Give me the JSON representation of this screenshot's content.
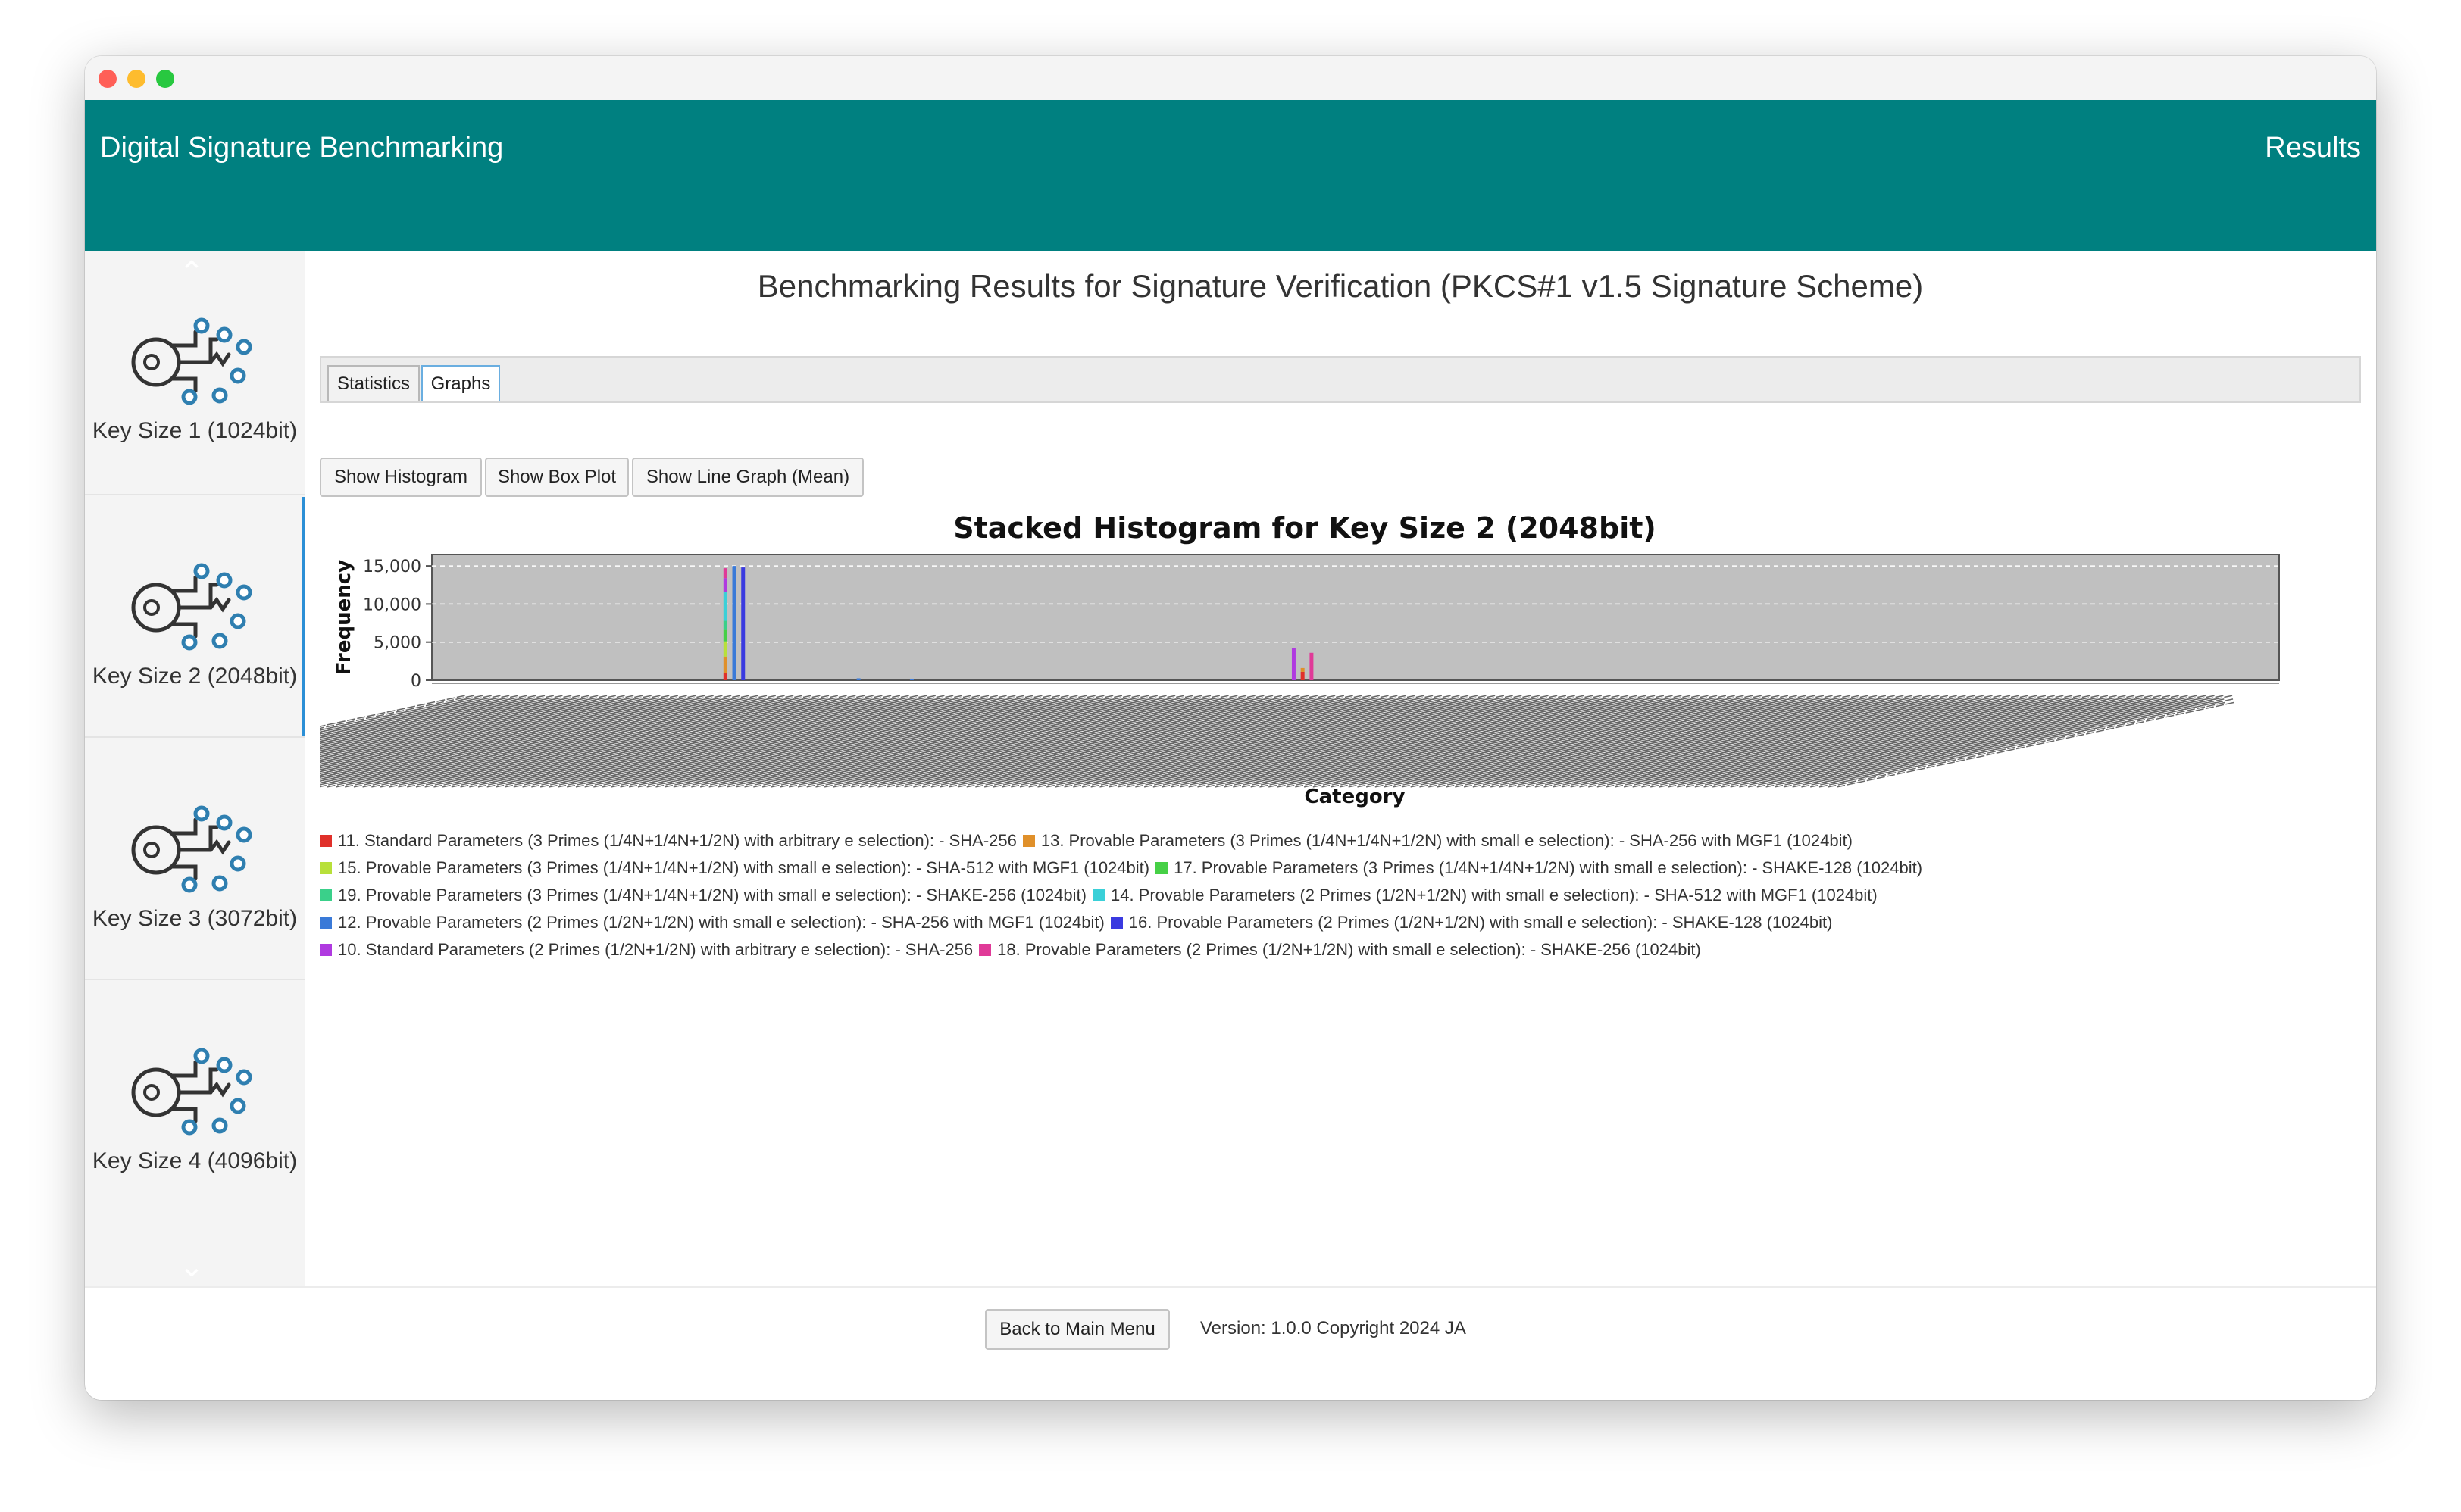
{
  "app": {
    "title": "Digital Signature Benchmarking",
    "section": "Results"
  },
  "sidebar": {
    "items": [
      {
        "label": "Key Size 1 (1024bit)",
        "icon": "key-circuit-icon"
      },
      {
        "label": "Key Size 2 (2048bit)",
        "icon": "key-circuit-icon",
        "selected": true
      },
      {
        "label": "Key Size 3 (3072bit)",
        "icon": "key-circuit-icon"
      },
      {
        "label": "Key Size 4 (4096bit)",
        "icon": "key-circuit-icon"
      }
    ]
  },
  "main": {
    "title": "Benchmarking Results for Signature Verification (PKCS#1 v1.5 Signature Scheme)",
    "tabs": [
      {
        "label": "Statistics"
      },
      {
        "label": "Graphs",
        "active": true
      }
    ],
    "buttons": {
      "histogram": "Show Histogram",
      "boxplot": "Show Box Plot",
      "linegraph": "Show Line Graph (Mean)"
    }
  },
  "chart_data": {
    "type": "bar",
    "stacked": true,
    "title": "Stacked Histogram for Key Size 2 (2048bit)",
    "xlabel": "Category",
    "ylabel": "Frequency",
    "ylim": [
      0,
      16500
    ],
    "yticks": [
      0,
      5000,
      10000,
      15000
    ],
    "ytick_labels": [
      "0",
      "5,000",
      "10,000",
      "15,000"
    ],
    "grid": true,
    "legend_position": "bottom",
    "category_count": 200,
    "series": [
      {
        "name": "11. Standard Parameters (3 Primes (1/4N+1/4N+1/2N) with arbitrary e selection): - SHA-256",
        "color": "#e0302a",
        "points": [
          [
            29,
            900
          ],
          [
            94,
            1100
          ]
        ]
      },
      {
        "name": "13. Provable Parameters (3 Primes (1/4N+1/4N+1/2N) with small e selection): - SHA-256 with MGF1 (1024bit)",
        "color": "#e0902a",
        "points": [
          [
            29,
            2200
          ],
          [
            94,
            500
          ]
        ]
      },
      {
        "name": "15. Provable Parameters (3 Primes (1/4N+1/4N+1/2N) with small e selection): - SHA-512 with MGF1 (1024bit)",
        "color": "#b8e03a",
        "points": [
          [
            29,
            2000
          ]
        ]
      },
      {
        "name": "17. Provable Parameters (3 Primes (1/4N+1/4N+1/2N) with small e selection): - SHAKE-128 (1024bit)",
        "color": "#46d046",
        "points": [
          [
            29,
            1500
          ]
        ]
      },
      {
        "name": "19. Provable Parameters (3 Primes (1/4N+1/4N+1/2N) with small e selection): - SHAKE-256 (1024bit)",
        "color": "#3ad08a",
        "points": [
          [
            29,
            1200
          ]
        ]
      },
      {
        "name": "14. Provable Parameters (2 Primes (1/2N+1/2N) with small e selection): - SHA-512 with MGF1 (1024bit)",
        "color": "#3ad0d8",
        "points": [
          [
            29,
            3800
          ]
        ]
      },
      {
        "name": "12. Provable Parameters (2 Primes (1/2N+1/2N) with small e selection): - SHA-256 with MGF1 (1024bit)",
        "color": "#3a7ad8",
        "points": [
          [
            30,
            15000
          ],
          [
            44,
            250
          ],
          [
            50,
            200
          ]
        ]
      },
      {
        "name": "16. Provable Parameters (2 Primes (1/2N+1/2N) with small e selection): - SHAKE-128 (1024bit)",
        "color": "#3a3ae0",
        "points": [
          [
            31,
            14800
          ]
        ]
      },
      {
        "name": "10. Standard Parameters (2 Primes (1/2N+1/2N) with arbitrary e selection): - SHA-256",
        "color": "#b03ae0",
        "points": [
          [
            29,
            1800
          ],
          [
            93,
            4200
          ]
        ]
      },
      {
        "name": "18. Provable Parameters (2 Primes (1/2N+1/2N) with small e selection): - SHAKE-256 (1024bit)",
        "color": "#e03a98",
        "points": [
          [
            29,
            1300
          ],
          [
            95,
            3600
          ]
        ]
      }
    ]
  },
  "footer": {
    "back_button": "Back to Main Menu",
    "version": "Version: 1.0.0 Copyright 2024 JA"
  }
}
